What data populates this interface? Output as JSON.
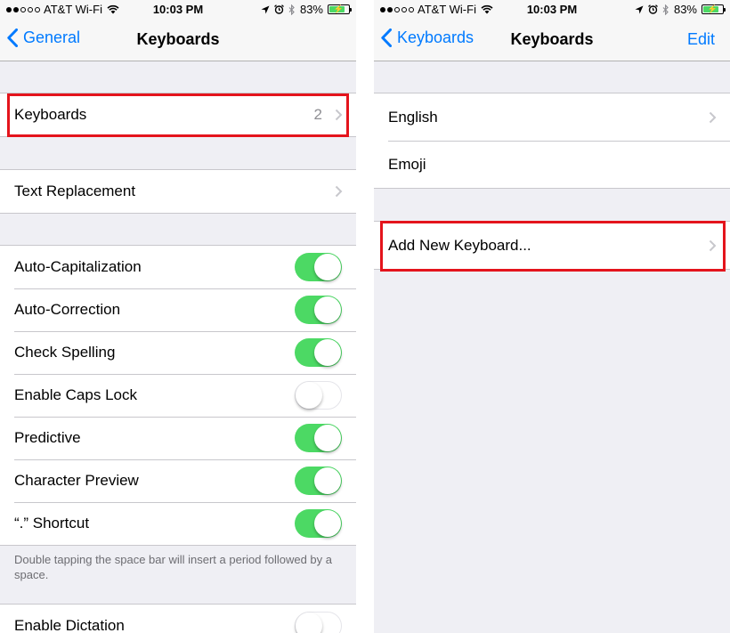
{
  "left": {
    "status": {
      "carrier": "AT&T Wi-Fi",
      "time": "10:03 PM",
      "battery": "83%",
      "battery_level": 0.83
    },
    "nav": {
      "back_label": "General",
      "title": "Keyboards"
    },
    "keyboards_row": {
      "label": "Keyboards",
      "value": "2"
    },
    "text_replacement": {
      "label": "Text Replacement"
    },
    "toggles": [
      {
        "label": "Auto-Capitalization",
        "on": true
      },
      {
        "label": "Auto-Correction",
        "on": true
      },
      {
        "label": "Check Spelling",
        "on": true
      },
      {
        "label": "Enable Caps Lock",
        "on": false
      },
      {
        "label": "Predictive",
        "on": true
      },
      {
        "label": "Character Preview",
        "on": true
      },
      {
        "label": "“.” Shortcut",
        "on": true
      }
    ],
    "shortcut_footer": "Double tapping the space bar will insert a period followed by a space.",
    "dictation": {
      "label": "Enable Dictation",
      "on": false
    }
  },
  "right": {
    "status": {
      "carrier": "AT&T Wi-Fi",
      "time": "10:03 PM",
      "battery": "83%",
      "battery_level": 0.83
    },
    "nav": {
      "back_label": "Keyboards",
      "title": "Keyboards",
      "edit_label": "Edit"
    },
    "keyboards": [
      {
        "label": "English"
      },
      {
        "label": "Emoji"
      }
    ],
    "add_keyboard": {
      "label": "Add New Keyboard..."
    }
  },
  "colors": {
    "accent": "#007aff",
    "toggle_on": "#4cd964",
    "highlight": "#e4141c",
    "background": "#efeff4"
  }
}
